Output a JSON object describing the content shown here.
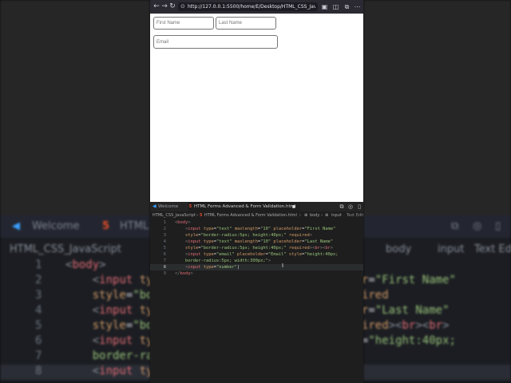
{
  "browser": {
    "url": "http://127.0.0.1:5500/home/E/Desktop/HTML_CSS_JavaScript/HTML...",
    "nav": {
      "back": "←",
      "forward": "→",
      "reload": "↻"
    },
    "form": {
      "first_name_placeholder": "First Name",
      "last_name_placeholder": "Last Name",
      "email_placeholder": "Email"
    }
  },
  "editor": {
    "tabs": [
      {
        "label": "Welcome"
      },
      {
        "label": "HTML Forms Advanced & Form Validation.html"
      }
    ],
    "breadcrumb": {
      "folder": "HTML_CSS_JavaScript",
      "file": "HTML Forms Advanced & Form Validation.html",
      "body": "body",
      "input": "input",
      "extra": "Text Edit"
    },
    "lines": [
      {
        "n": "1",
        "parts": [
          {
            "c": "br",
            "t": "<"
          },
          {
            "c": "tag",
            "t": "body"
          },
          {
            "c": "br",
            "t": ">"
          }
        ]
      },
      {
        "n": "2",
        "indent": 1,
        "parts": [
          {
            "c": "br",
            "t": "<"
          },
          {
            "c": "tag",
            "t": "input"
          },
          {
            "c": "attr",
            "t": " type"
          },
          {
            "c": "pl",
            "t": "="
          },
          {
            "c": "str",
            "t": "\"text\""
          },
          {
            "c": "attr",
            "t": " maxlength"
          },
          {
            "c": "pl",
            "t": "="
          },
          {
            "c": "str",
            "t": "\"10\""
          },
          {
            "c": "attr",
            "t": " placeholder"
          },
          {
            "c": "pl",
            "t": "="
          },
          {
            "c": "str",
            "t": "\"First Name\""
          }
        ]
      },
      {
        "n": "3",
        "indent": 1,
        "parts": [
          {
            "c": "attr",
            "t": "style"
          },
          {
            "c": "pl",
            "t": "="
          },
          {
            "c": "str",
            "t": "\"border-radius:5px; height:40px;\""
          },
          {
            "c": "attr",
            "t": " required"
          },
          {
            "c": "br",
            "t": ">"
          }
        ]
      },
      {
        "n": "4",
        "indent": 1,
        "parts": [
          {
            "c": "br",
            "t": "<"
          },
          {
            "c": "tag",
            "t": "input"
          },
          {
            "c": "attr",
            "t": " type"
          },
          {
            "c": "pl",
            "t": "="
          },
          {
            "c": "str",
            "t": "\"text\""
          },
          {
            "c": "attr",
            "t": " maxlength"
          },
          {
            "c": "pl",
            "t": "="
          },
          {
            "c": "str",
            "t": "\"10\""
          },
          {
            "c": "attr",
            "t": " placeholder"
          },
          {
            "c": "pl",
            "t": "="
          },
          {
            "c": "str",
            "t": "\"Last Name\""
          }
        ]
      },
      {
        "n": "5",
        "indent": 1,
        "parts": [
          {
            "c": "attr",
            "t": "style"
          },
          {
            "c": "pl",
            "t": "="
          },
          {
            "c": "str",
            "t": "\"border-radius:5px; height:40px;\""
          },
          {
            "c": "attr",
            "t": " required"
          },
          {
            "c": "br",
            "t": "><"
          },
          {
            "c": "tag",
            "t": "br"
          },
          {
            "c": "br",
            "t": "><"
          },
          {
            "c": "tag",
            "t": "br"
          },
          {
            "c": "br",
            "t": ">"
          }
        ]
      },
      {
        "n": "6",
        "indent": 1,
        "parts": [
          {
            "c": "br",
            "t": "<"
          },
          {
            "c": "tag",
            "t": "input"
          },
          {
            "c": "attr",
            "t": " type"
          },
          {
            "c": "pl",
            "t": "="
          },
          {
            "c": "str",
            "t": "\"email\""
          },
          {
            "c": "attr",
            "t": " placeholder"
          },
          {
            "c": "pl",
            "t": "="
          },
          {
            "c": "str",
            "t": "\"Email\""
          },
          {
            "c": "attr",
            "t": " style"
          },
          {
            "c": "pl",
            "t": "="
          },
          {
            "c": "str",
            "t": "\"height:40px;"
          }
        ]
      },
      {
        "n": "7",
        "indent": 1,
        "parts": [
          {
            "c": "str",
            "t": "border-radius:5px; width:300px;\""
          },
          {
            "c": "br",
            "t": ">"
          }
        ]
      },
      {
        "n": "8",
        "indent": 1,
        "current": true,
        "parts": [
          {
            "c": "br",
            "t": "<"
          },
          {
            "c": "tag",
            "t": "input"
          },
          {
            "c": "attr",
            "t": " type"
          },
          {
            "c": "pl",
            "t": "="
          },
          {
            "c": "str",
            "t": "\"number\""
          },
          {
            "c": "pl",
            "t": "|"
          }
        ]
      },
      {
        "n": "9",
        "parts": [
          {
            "c": "br",
            "t": "</"
          },
          {
            "c": "tag",
            "t": "body"
          },
          {
            "c": "br",
            "t": ">"
          }
        ]
      }
    ]
  },
  "background": {
    "tabs": [
      {
        "label": "Welcome"
      },
      {
        "label": "HTML"
      }
    ],
    "breadcrumb": {
      "folder": "HTML_CSS_JavaScript",
      "body": "body",
      "input": "input",
      "extra": "Text Edit"
    },
    "lines": [
      {
        "n": "1",
        "parts": [
          {
            "c": "br",
            "t": "<"
          },
          {
            "c": "tag",
            "t": "body"
          },
          {
            "c": "br",
            "t": ">"
          }
        ]
      },
      {
        "n": "2",
        "parts": [
          {
            "c": "pl",
            "t": "    "
          },
          {
            "c": "br",
            "t": "<"
          },
          {
            "c": "tag",
            "t": "input"
          },
          {
            "c": "attr",
            "t": " ty"
          },
          {
            "c": "pl",
            "t": "                          "
          },
          {
            "c": "attr",
            "t": "holder"
          },
          {
            "c": "pl",
            "t": "="
          },
          {
            "c": "str",
            "t": "\"First Name\""
          }
        ]
      },
      {
        "n": "3",
        "parts": [
          {
            "c": "pl",
            "t": "    "
          },
          {
            "c": "attr",
            "t": "style"
          },
          {
            "c": "pl",
            "t": "="
          },
          {
            "c": "str",
            "t": "\"bor"
          },
          {
            "c": "pl",
            "t": "                          "
          },
          {
            "c": "attr",
            "t": "required"
          }
        ]
      },
      {
        "n": "4",
        "parts": [
          {
            "c": "pl",
            "t": "    "
          },
          {
            "c": "br",
            "t": "<"
          },
          {
            "c": "tag",
            "t": "input"
          },
          {
            "c": "attr",
            "t": " ty"
          },
          {
            "c": "pl",
            "t": "                          "
          },
          {
            "c": "attr",
            "t": "holder"
          },
          {
            "c": "pl",
            "t": "="
          },
          {
            "c": "str",
            "t": "\"Last Name\""
          }
        ]
      },
      {
        "n": "5",
        "parts": [
          {
            "c": "pl",
            "t": "    "
          },
          {
            "c": "attr",
            "t": "style"
          },
          {
            "c": "pl",
            "t": "="
          },
          {
            "c": "str",
            "t": "\"bor"
          },
          {
            "c": "pl",
            "t": "                          "
          },
          {
            "c": "attr",
            "t": "required"
          },
          {
            "c": "br",
            "t": "><"
          },
          {
            "c": "tag",
            "t": "br"
          },
          {
            "c": "br",
            "t": "><"
          },
          {
            "c": "tag",
            "t": "br"
          },
          {
            "c": "br",
            "t": ">"
          }
        ]
      },
      {
        "n": "6",
        "parts": [
          {
            "c": "pl",
            "t": "    "
          },
          {
            "c": "br",
            "t": "<"
          },
          {
            "c": "tag",
            "t": "input"
          },
          {
            "c": "attr",
            "t": " ty"
          },
          {
            "c": "pl",
            "t": "                          "
          },
          {
            "c": "attr",
            "t": "style"
          },
          {
            "c": "pl",
            "t": "="
          },
          {
            "c": "str",
            "t": "\"height:40px;"
          }
        ]
      },
      {
        "n": "7",
        "parts": [
          {
            "c": "pl",
            "t": "    "
          },
          {
            "c": "str",
            "t": "border-ra"
          }
        ]
      },
      {
        "n": "8",
        "current": true,
        "parts": [
          {
            "c": "pl",
            "t": "    "
          },
          {
            "c": "br",
            "t": "<"
          },
          {
            "c": "tag",
            "t": "input"
          },
          {
            "c": "attr",
            "t": " ty"
          }
        ]
      }
    ]
  }
}
